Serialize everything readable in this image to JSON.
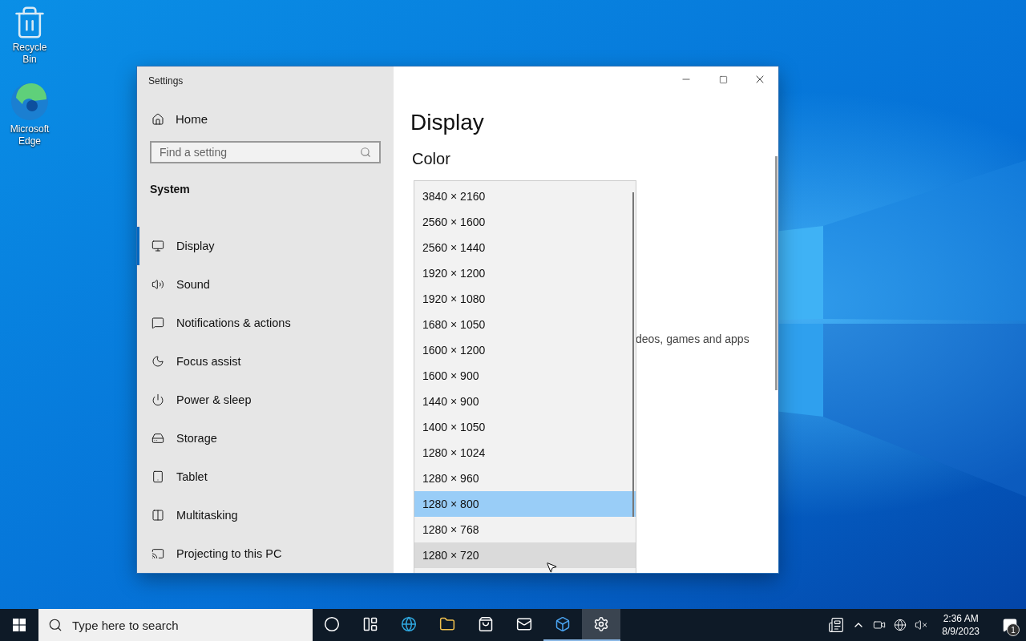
{
  "desktop_icons": [
    {
      "kind": "recycle",
      "label": "Recycle Bin"
    },
    {
      "kind": "edge",
      "label": "Microsoft Edge"
    }
  ],
  "window": {
    "title": "Settings"
  },
  "sidebar": {
    "home": "Home",
    "search": {
      "placeholder": "Find a setting"
    },
    "section": "System",
    "items": [
      {
        "kind": "display",
        "label": "Display",
        "selected": true
      },
      {
        "kind": "sound",
        "label": "Sound",
        "selected": false
      },
      {
        "kind": "notifications",
        "label": "Notifications & actions",
        "selected": false
      },
      {
        "kind": "focus",
        "label": "Focus assist",
        "selected": false
      },
      {
        "kind": "power",
        "label": "Power & sleep",
        "selected": false
      },
      {
        "kind": "storage",
        "label": "Storage",
        "selected": false
      },
      {
        "kind": "tablet",
        "label": "Tablet",
        "selected": false
      },
      {
        "kind": "multitasking",
        "label": "Multitasking",
        "selected": false
      },
      {
        "kind": "projecting",
        "label": "Projecting to this PC",
        "selected": false
      }
    ]
  },
  "content": {
    "heading": "Display",
    "subheading": "Color",
    "partial_text": "deos, games and apps"
  },
  "dropdown": {
    "items": [
      {
        "label": "3840 × 2160",
        "selected": false,
        "hovered": false
      },
      {
        "label": "2560 × 1600",
        "selected": false,
        "hovered": false
      },
      {
        "label": "2560 × 1440",
        "selected": false,
        "hovered": false
      },
      {
        "label": "1920 × 1200",
        "selected": false,
        "hovered": false
      },
      {
        "label": "1920 × 1080",
        "selected": false,
        "hovered": false
      },
      {
        "label": "1680 × 1050",
        "selected": false,
        "hovered": false
      },
      {
        "label": "1600 × 1200",
        "selected": false,
        "hovered": false
      },
      {
        "label": "1600 × 900",
        "selected": false,
        "hovered": false
      },
      {
        "label": "1440 × 900",
        "selected": false,
        "hovered": false
      },
      {
        "label": "1400 × 1050",
        "selected": false,
        "hovered": false
      },
      {
        "label": "1280 × 1024",
        "selected": false,
        "hovered": false
      },
      {
        "label": "1280 × 960",
        "selected": false,
        "hovered": false
      },
      {
        "label": "1280 × 800",
        "selected": true,
        "hovered": false
      },
      {
        "label": "1280 × 768",
        "selected": false,
        "hovered": false
      },
      {
        "label": "1280 × 720",
        "selected": false,
        "hovered": true
      }
    ]
  },
  "taskbar": {
    "search": {
      "placeholder": "Type here to search"
    },
    "apps": [
      {
        "kind": "cortana",
        "running": false,
        "active": false
      },
      {
        "kind": "taskview",
        "running": false,
        "active": false
      },
      {
        "kind": "edge",
        "running": false,
        "active": false
      },
      {
        "kind": "explorer",
        "running": false,
        "active": false
      },
      {
        "kind": "store",
        "running": false,
        "active": false
      },
      {
        "kind": "mail",
        "running": false,
        "active": false
      },
      {
        "kind": "sandbox",
        "running": true,
        "active": false
      },
      {
        "kind": "settings",
        "running": true,
        "active": true
      }
    ],
    "time": "2:36 AM",
    "date": "8/9/2023",
    "notification_count": "1"
  }
}
